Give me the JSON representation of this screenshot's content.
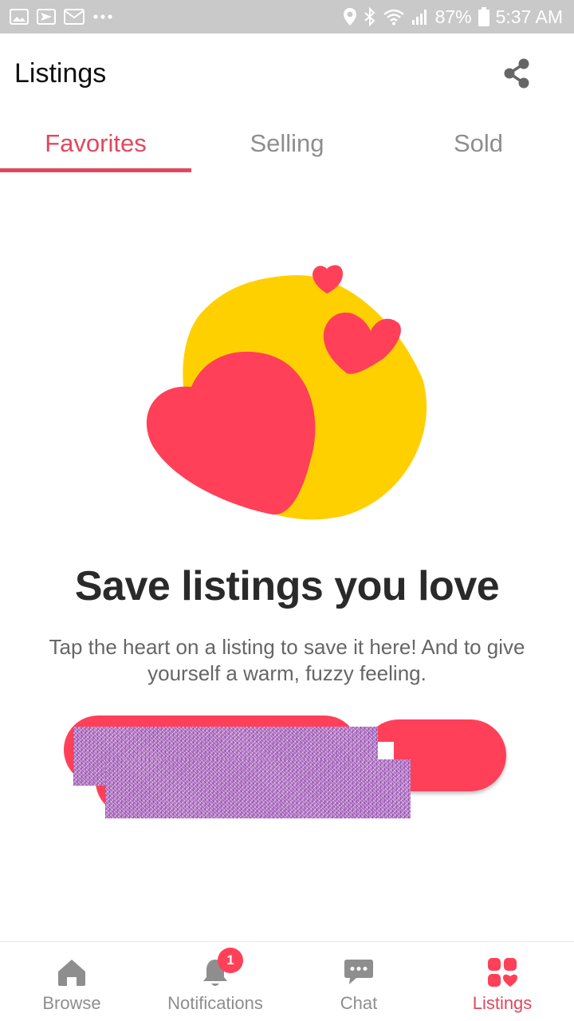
{
  "status_bar": {
    "left_icons": [
      "image-icon",
      "send-icon",
      "mail-icon",
      "more-dots-icon"
    ],
    "battery": "87%",
    "time": "5:37 AM",
    "right_icons": [
      "location-icon",
      "bluetooth-icon",
      "wifi-icon",
      "signal-icon",
      "battery-icon"
    ]
  },
  "app_bar": {
    "title": "Listings",
    "share_icon": "share-icon"
  },
  "tabs": [
    {
      "label": "Favorites",
      "active": true
    },
    {
      "label": "Selling",
      "active": false
    },
    {
      "label": "Sold",
      "active": false
    }
  ],
  "empty_state": {
    "illustration": "hearts-illustration",
    "headline": "Save listings you love",
    "description": "Tap the heart on a listing to save it here! And to give yourself a warm, fuzzy feeling."
  },
  "bottom_nav": [
    {
      "label": "Browse",
      "icon": "home-icon",
      "active": false
    },
    {
      "label": "Notifications",
      "icon": "bell-icon",
      "badge": "1",
      "active": false
    },
    {
      "label": "Chat",
      "icon": "chat-icon",
      "active": false
    },
    {
      "label": "Listings",
      "icon": "listings-grid-icon",
      "active": true
    }
  ],
  "colors": {
    "accent": "#e2485d",
    "heart": "#ff4058",
    "sun": "#ffd000",
    "status_bar": "#c9c9c9"
  }
}
